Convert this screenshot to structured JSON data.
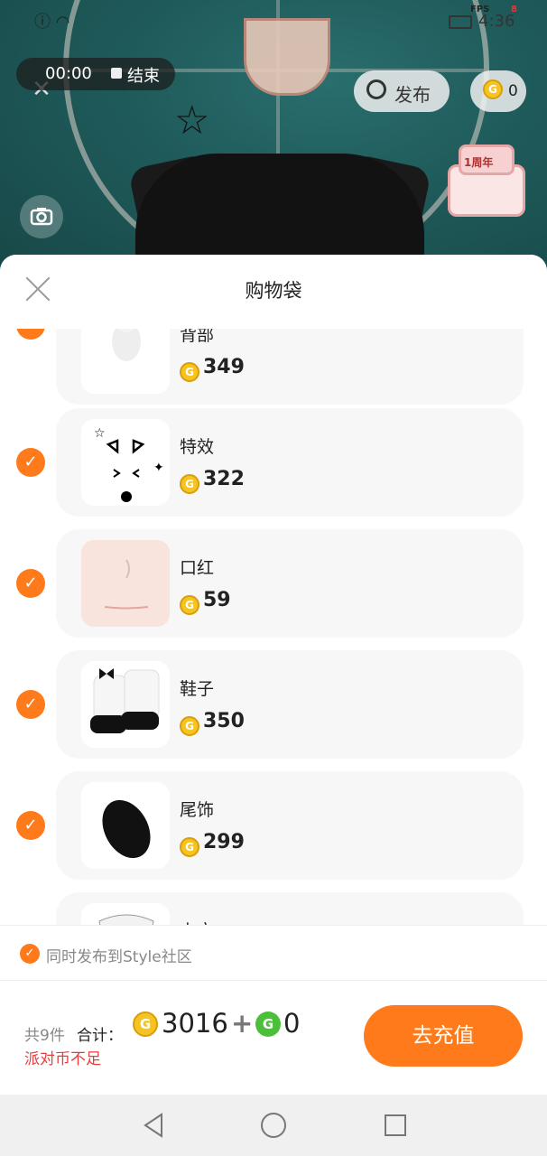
{
  "status_bar": {
    "fps_label": "FPS",
    "fps_value": "8",
    "time": "4:36"
  },
  "recording": {
    "elapsed": "00:00",
    "stop_label": "结束"
  },
  "top_actions": {
    "publish_label": "发布",
    "coin_balance": "0"
  },
  "cake_flag": "1周年",
  "sheet": {
    "title": "购物袋",
    "items": [
      {
        "name": "背部",
        "price": "349",
        "checked": true
      },
      {
        "name": "特效",
        "price": "322",
        "checked": true
      },
      {
        "name": "口红",
        "price": "59",
        "checked": true
      },
      {
        "name": "鞋子",
        "price": "350",
        "checked": true
      },
      {
        "name": "尾饰",
        "price": "299",
        "checked": true
      },
      {
        "name": "上衣",
        "price": "",
        "checked": true
      }
    ],
    "sync_label": "同时发布到Style社区",
    "footer": {
      "count": "共9件",
      "total_label": "合计：",
      "total_coins": "3016",
      "plus": "+",
      "total_green": "0",
      "warning": "派对币不足",
      "recharge_label": "去充值"
    }
  },
  "colors": {
    "accent": "#ff7a1a",
    "coin_gold": "#f5c423",
    "coin_green": "#4cbf3a",
    "warning": "#e83d3d"
  },
  "icons": {
    "check": "check-icon",
    "close": "close-icon",
    "camera": "camera-icon",
    "publish": "edit-icon",
    "coin": "coin-icon"
  }
}
